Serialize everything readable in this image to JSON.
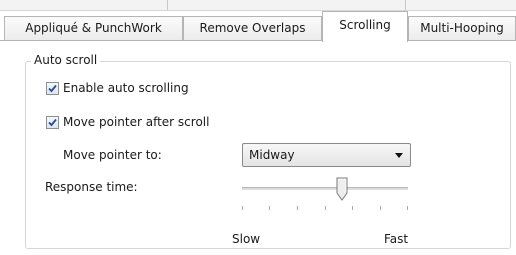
{
  "tabs": [
    {
      "label": "Appliqué & PunchWork",
      "active": false
    },
    {
      "label": "Remove Overlaps",
      "active": false
    },
    {
      "label": "Scrolling",
      "active": true
    },
    {
      "label": "Multi-Hooping",
      "active": false
    }
  ],
  "group": {
    "title": "Auto scroll",
    "enable_auto_scrolling": {
      "label": "Enable auto scrolling",
      "checked": true
    },
    "move_pointer_after_scroll": {
      "label": "Move pointer after scroll",
      "checked": true
    },
    "move_pointer_to": {
      "label": "Move pointer to:",
      "selected": "Midway"
    },
    "response_time": {
      "label": "Response time:",
      "level": 0.6,
      "min_label": "Slow",
      "max_label": "Fast"
    }
  },
  "colors": {
    "tab_border": "#b5b5b5",
    "group_border": "#d6d6d6",
    "check_color": "#2c4a8c"
  },
  "icons": {
    "check": "checkmark-icon",
    "dropdown": "chevron-down-icon",
    "slider_thumb": "slider-thumb"
  }
}
